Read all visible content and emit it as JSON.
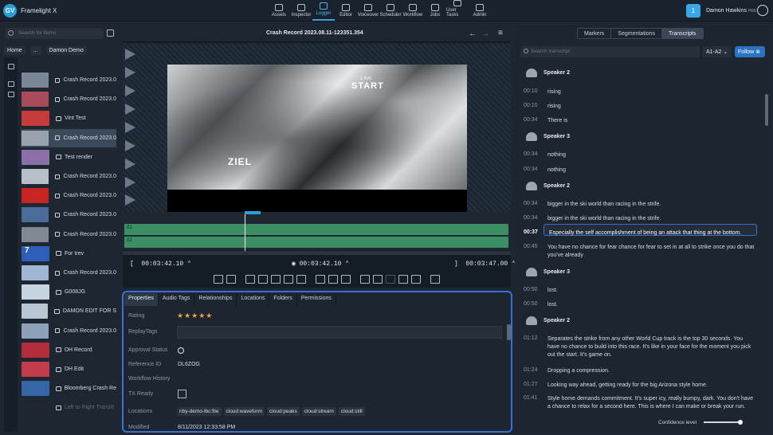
{
  "app": {
    "name": "Framelight X",
    "logo": "GV"
  },
  "nav": [
    {
      "label": "Assets",
      "icon": "assets-icon"
    },
    {
      "label": "Inspector",
      "icon": "inspector-icon"
    },
    {
      "label": "Logger",
      "icon": "logger-icon",
      "active": true
    },
    {
      "label": "Editor",
      "icon": "editor-icon"
    },
    {
      "label": "Voiceover",
      "icon": "microphone-icon"
    },
    {
      "label": "Scheduler",
      "icon": "scheduler-icon"
    },
    {
      "label": "Workflow",
      "icon": "workflow-icon"
    },
    {
      "label": "Jobs",
      "icon": "jobs-icon"
    },
    {
      "label": "User Tasks",
      "icon": "user-tasks-icon"
    },
    {
      "label": "Admin",
      "icon": "admin-icon"
    }
  ],
  "user": {
    "badge": "1",
    "name": "Damon Hawkins",
    "tag": "PRE"
  },
  "left": {
    "search_placeholder": "Search for items",
    "breadcrumb": [
      "Home",
      "...",
      "Damon Demo"
    ],
    "items": [
      {
        "label": "Crash Record 2023.0",
        "color": "#7a8796"
      },
      {
        "label": "Crash Record 2023.0",
        "color": "#a84a5a"
      },
      {
        "label": "Vint Test",
        "color": "#c63a3a"
      },
      {
        "label": "Crash Record 2023.0",
        "color": "#9aa3ad",
        "selected": true
      },
      {
        "label": "Test render",
        "color": "#8a6fa8"
      },
      {
        "label": "Crash Record 2023.0",
        "color": "#b7c0c9"
      },
      {
        "label": "Crash Record 2023.0",
        "color": "#c92424"
      },
      {
        "label": "Crash Record 2023.0",
        "color": "#4d6b9a"
      },
      {
        "label": "Crash Record 2023.0",
        "color": "#7f8a94"
      },
      {
        "label": "For trev",
        "color": "#2d5fb8",
        "thumbtext": "7"
      },
      {
        "label": "Crash Record 2023.0",
        "color": "#9fb6d4"
      },
      {
        "label": "G008JG",
        "color": "#c6d3e0"
      },
      {
        "label": "DAMON EDIT FOR S",
        "color": "#b8c5d2"
      },
      {
        "label": "Crash Record 2023.0",
        "color": "#8da2b8"
      },
      {
        "label": "DH Record",
        "color": "#b52d3c"
      },
      {
        "label": "DH Edit",
        "color": "#c33c4c"
      },
      {
        "label": "Bloomberg Crash Re",
        "color": "#3766a8"
      },
      {
        "label": "Left to Right Transiti",
        "color": "#1d2631",
        "dim": true
      }
    ]
  },
  "clip": {
    "title": "Crash Record 2023.08.11-123351.354",
    "overlay_start": "START",
    "overlay_ziel": "ZIEL",
    "overlay_dist": "1 Km"
  },
  "timeline": {
    "tracks": [
      "01",
      "02"
    ],
    "in": "00:03:42.10",
    "current": "00:03:42.10",
    "out": "00:03:47.00"
  },
  "properties": {
    "tabs": [
      "Properties",
      "Audio Tags",
      "Relationships",
      "Locations",
      "Folders",
      "Permissions"
    ],
    "rating_label": "Rating",
    "rating": "★★★★★",
    "replay_label": "ReplayTags",
    "approval_label": "Approval Status",
    "reference_label": "Reference ID",
    "reference": "DL6ZOG",
    "workflow_label": "Workflow History",
    "tx_label": "TX Ready",
    "locations_label": "Locations",
    "locations": [
      "nby-demo-lbc:file",
      "cloud:waveform",
      "cloud:peaks",
      "cloud:stream",
      "cloud:still"
    ],
    "modified_label": "Modified",
    "modified": "8/11/2023 12:33:58 PM"
  },
  "transcript": {
    "tabs": [
      "Markers",
      "Segmentations",
      "Transcripts"
    ],
    "search_placeholder": "Search transcript",
    "channel": "A1-A2",
    "follow": "Follow",
    "confidence_label": "Confidence level",
    "blocks": [
      {
        "speaker": "Speaker 2"
      },
      {
        "time": "00:10",
        "text": "rising"
      },
      {
        "time": "00:10",
        "text": "rising"
      },
      {
        "time": "00:34",
        "text": "There is"
      },
      {
        "speaker": "Speaker 3"
      },
      {
        "time": "00:34",
        "text": "nothing"
      },
      {
        "time": "00:34",
        "text": "nothing"
      },
      {
        "speaker": "Speaker 2"
      },
      {
        "time": "00:34",
        "text": "bigger in the ski world than racing in the strife."
      },
      {
        "time": "00:34",
        "text": "bigger in the ski world than racing in the strife."
      },
      {
        "time": "00:37",
        "text": "Especially the self accomplishment of being an attack that thing at the bottom.",
        "active": true
      },
      {
        "time": "00:45",
        "text": "You have no chance for fear chance for fear to set in at all to strike once you do that you've already"
      },
      {
        "speaker": "Speaker 3"
      },
      {
        "time": "00:50",
        "text": "lost."
      },
      {
        "time": "00:50",
        "text": "lost."
      },
      {
        "speaker": "Speaker 2"
      },
      {
        "time": "01:12",
        "text": "Separates the strike from any other World Cup track is the top 30 seconds. You have no chance to build into this race. It's like in your face for the moment you pick out the start. It's game on."
      },
      {
        "time": "01:24",
        "text": "Dropping a compression."
      },
      {
        "time": "01:27",
        "text": "Looking way ahead, getting ready for the big Arizona style home."
      },
      {
        "time": "01:41",
        "text": "Style home demands commitment. It's super icy, really bumpy, dark. You don't have a chance to relax for a second here. This is where I can make or break your run."
      }
    ]
  }
}
